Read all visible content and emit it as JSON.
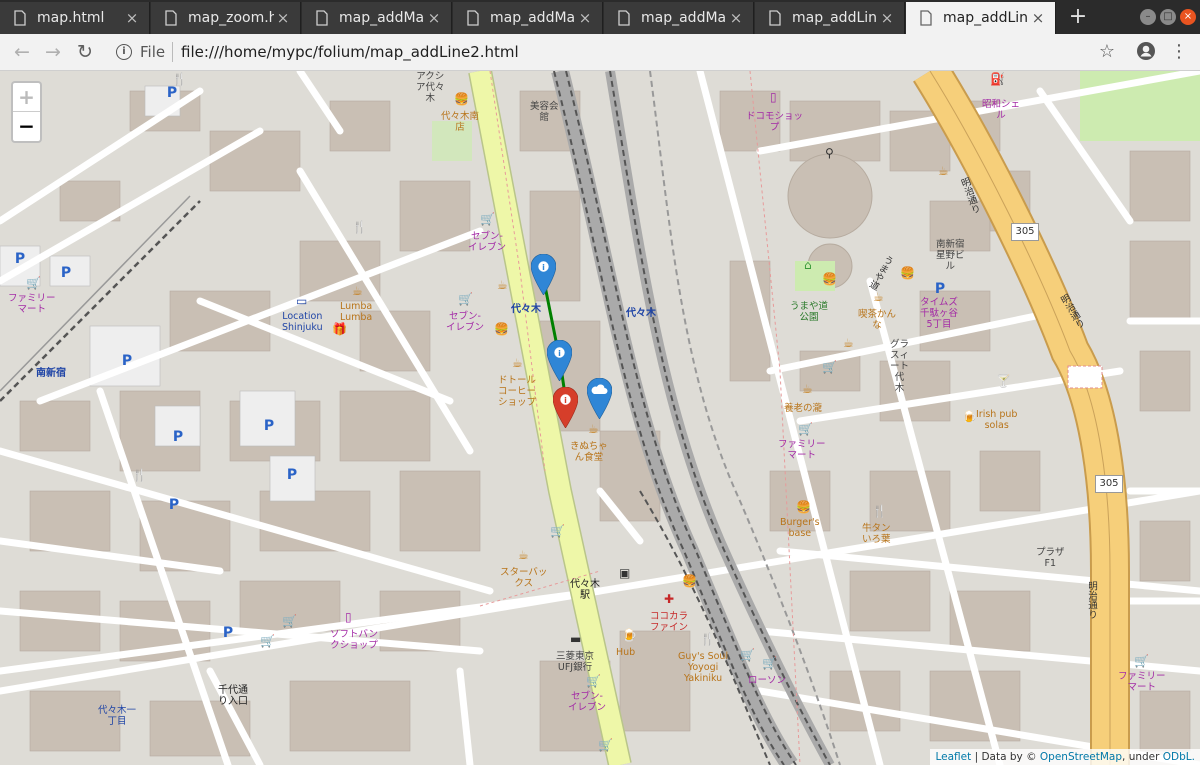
{
  "browser": {
    "tabs": [
      {
        "label": "map.html",
        "close": "×"
      },
      {
        "label": "map_zoom.h",
        "close": "×"
      },
      {
        "label": "map_addMa",
        "close": "×"
      },
      {
        "label": "map_addMa",
        "close": "×"
      },
      {
        "label": "map_addMa",
        "close": "×"
      },
      {
        "label": "map_addLin",
        "close": "×"
      },
      {
        "label": "map_addLin",
        "close": "×"
      }
    ],
    "active_tab": 6,
    "new_tab": "+",
    "url_scheme": "File",
    "url": "file:///home/mypc/folium/map_addLine2.html"
  },
  "map": {
    "zoom_in": "+",
    "zoom_out": "−",
    "colors": {
      "land": "#dedcd6",
      "building": "#c9bfb4",
      "major_road": "#eef7a8",
      "motorway": "#f6cf7a",
      "line": "#008000",
      "marker_blue": "#2f86d6",
      "marker_red": "#d63e2a"
    },
    "markers": [
      {
        "icon": "info-sign-icon",
        "color": "blue"
      },
      {
        "icon": "info-sign-icon",
        "color": "blue"
      },
      {
        "icon": "cloud-icon",
        "color": "blue"
      },
      {
        "icon": "info-sign-icon",
        "color": "red"
      }
    ],
    "labels": {
      "akushiyoyogi": "アクシ\nア代々\n木",
      "yoyogi_station_1": "代々木南\n店",
      "biyoukaikan": "美容会\n館",
      "docomo": "ドコモショッ\nプ",
      "showa_shell": "昭和シェ\nル",
      "seven1": "セブン-\nイレブン",
      "seven2": "セブン-\nイレブン",
      "seven3": "セブン-\nイレブン",
      "family1": "ファミリー\nマート",
      "family2": "ファミリー\nマート",
      "family3": "ファミリー\nマート",
      "location_shinjuku": "Location\nShinjuku",
      "lumba": "Lumba\nLumba",
      "yoyogi_a": "代々木",
      "yoyogi_b": "代々木",
      "minami_shinjuku": "南新宿",
      "doutor": "ドトール\nコーヒー\nショップ",
      "kinuchan": "きぬちゃ\nん食堂",
      "starbucks": "スターバッ\nクス",
      "yoyogi_eki": "代々木\n駅",
      "cococara": "ココカラ\nファイン",
      "mufg": "三菱東京\nUFJ銀行",
      "hub": "Hub",
      "guys_soul": "Guy's Soul\nYoyogi\nYakiniku",
      "lawson": "ローソン",
      "softbank": "ソフトバン\nクショップ",
      "sendagaya": "千代通\nり入口",
      "yoyogi_1": "代々木一\n丁目",
      "umaya_park": "うまや道\n公園",
      "kissa": "喫茶かん\nな",
      "times": "タイムズ\n千駄ヶ谷\n5丁目",
      "minami_shinjuku_hoshi": "南新宿\n星野ビ\nル",
      "grand_suite": "グラ\nスィ\nート\n代\n木",
      "yourou": "養老の瀧",
      "irish": "Irish pub\nsolas",
      "burgers": "Burger's\nbase",
      "gyutan": "牛タン\nいろ葉",
      "plaza": "プラザ\nF1",
      "meiji1": "明治通り",
      "meiji2": "明治通り",
      "meiji3": "明治通り",
      "umayamichi": "うまや道",
      "route305a": "305",
      "route305b": "305"
    }
  },
  "attribution": {
    "leaflet": "Leaflet",
    "sep1": " | Data by © ",
    "osm": "OpenStreetMap",
    "sep2": ", under ",
    "odbl": "ODbL."
  }
}
